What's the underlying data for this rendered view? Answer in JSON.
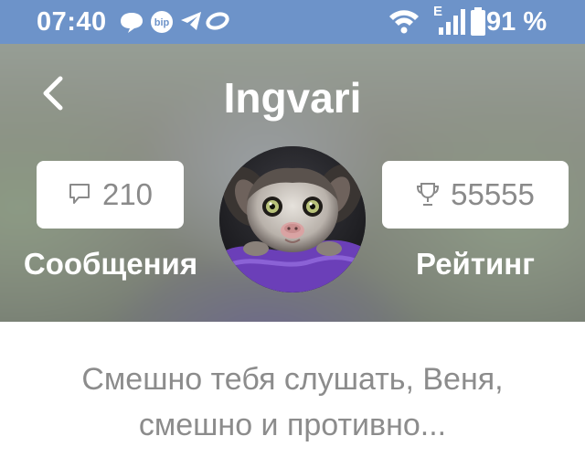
{
  "status_bar": {
    "time": "07:40",
    "network_label": "E",
    "battery": "91 %",
    "left_icons": [
      "chat-bubble-icon",
      "bip-icon",
      "telegram-icon",
      "infinity-icon"
    ],
    "right_icons": [
      "wifi-icon",
      "signal-icon",
      "battery-icon"
    ],
    "bip_label": "bip",
    "background_color": "#6d93c9"
  },
  "header": {
    "title": "Ingvari",
    "back_icon": "back-chevron-icon"
  },
  "stats": {
    "messages": {
      "value": "210",
      "label": "Сообщения",
      "icon": "message-bubble-icon"
    },
    "rating": {
      "value": "55555",
      "label": "Рейтинг",
      "icon": "trophy-icon"
    }
  },
  "avatar": {
    "description_icon": "lemur-avatar"
  },
  "bio": {
    "line1": "Смешно тебя слушать, Веня,",
    "line2": "смешно и противно..."
  },
  "colors": {
    "stat_text": "#8a8a8a",
    "bio_text": "#8c8c8c",
    "avatar_cloth": "#6b3fb8"
  }
}
